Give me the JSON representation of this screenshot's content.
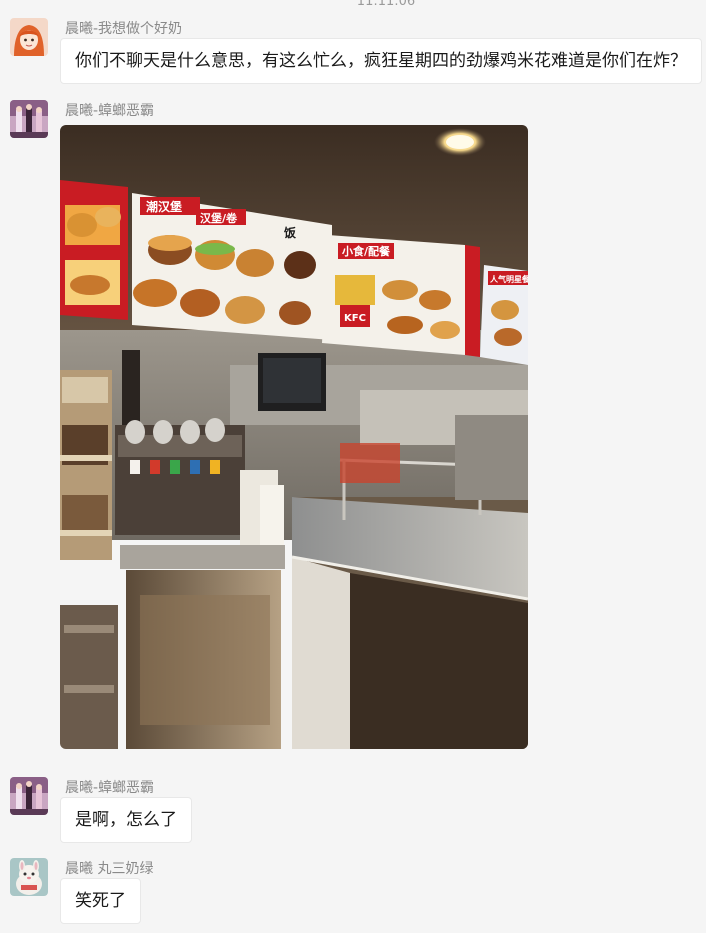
{
  "chat": {
    "timestamp": "11:11:06",
    "messages": [
      {
        "sender": "晨曦-我想做个好奶",
        "text": "你们不聊天是什么意思，有这么忙么，疯狂星期四的劲爆鸡米花难道是你们在炸？"
      },
      {
        "sender": "晨曦-蟑螂恶霸",
        "image": {
          "menu_sections": [
            "潮汉堡",
            "汉堡/卷",
            "饭",
            "小食/配餐",
            "人气明星餐"
          ],
          "brand": "KFC"
        }
      },
      {
        "sender": "晨曦-蟑螂恶霸",
        "text": "是啊，怎么了"
      },
      {
        "sender": "晨曦 丸三奶绿",
        "text": "笑死了"
      }
    ]
  },
  "colors": {
    "background": "#f5f5f5",
    "bubble": "#ffffff",
    "sender_text": "#8a8a8a"
  }
}
